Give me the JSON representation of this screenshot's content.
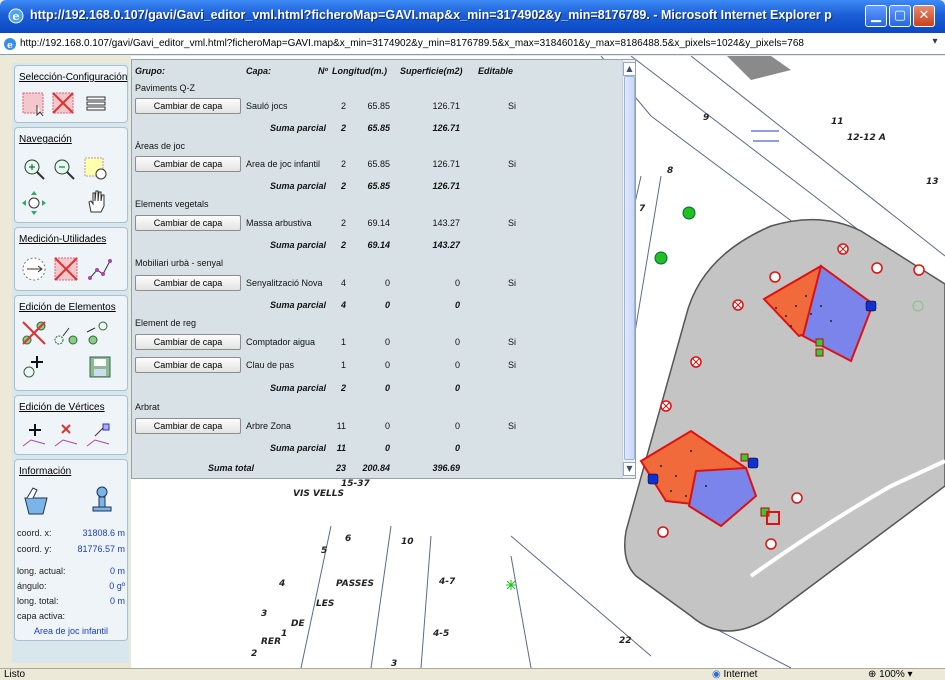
{
  "window": {
    "title": "http://192.168.0.107/gavi/Gavi_editor_vml.html?ficheroMap=GAVI.map&x_min=3174902&y_min=8176789. - Microsoft Internet Explorer p",
    "address": "http://192.168.0.107/gavi/Gavi_editor_vml.html?ficheroMap=GAVI.map&x_min=3174902&y_min=8176789.5&x_max=3184601&y_max=8186488.5&x_pixels=1024&y_pixels=768"
  },
  "status": {
    "text": "Listo",
    "zone": "Internet",
    "zoom": "100%"
  },
  "sidebar": {
    "sections": {
      "seleccion": "Selección-Configuración",
      "navegacion": "Navegación",
      "medicion": "Medición-Utilidades",
      "edicion_elementos": "Edición de Elementos",
      "edicion_vertices": "Edición de Vértices",
      "informacion": "Información"
    },
    "info": {
      "coord_x_label": "coord. x:",
      "coord_x": "31808.6 m",
      "coord_y_label": "coord. y:",
      "coord_y": "81776.57 m",
      "long_actual_label": "long. actual:",
      "long_actual": "0 m",
      "angulo_label": "ángulo:",
      "angulo": "0 gº",
      "long_total_label": "long. total:",
      "long_total": "0 m",
      "capa_activa_label": "capa activa:",
      "capa_activa": "Area de joc infantil"
    }
  },
  "table": {
    "headers": {
      "grupo": "Grupo:",
      "capa": "Capa:",
      "num": "Nº",
      "longitud": "Longitud(m.)",
      "superficie": "Superficie(m2)",
      "editable": "Editable"
    },
    "button_label": "Cambiar de capa",
    "subtotal_label": "Suma parcial",
    "total_label": "Suma total",
    "groups": [
      {
        "name": "Paviments Q-Z",
        "rows": [
          {
            "capa": "Sauló jocs",
            "n": "2",
            "long": "65.85",
            "sup": "126.71",
            "edit": "Si"
          }
        ],
        "sub": {
          "n": "2",
          "long": "65.85",
          "sup": "126.71"
        }
      },
      {
        "name": "Àreas de joc",
        "rows": [
          {
            "capa": "Area de joc infantil",
            "n": "2",
            "long": "65.85",
            "sup": "126.71",
            "edit": "Si"
          }
        ],
        "sub": {
          "n": "2",
          "long": "65.85",
          "sup": "126.71"
        }
      },
      {
        "name": "Elements vegetals",
        "rows": [
          {
            "capa": "Massa arbustiva",
            "n": "2",
            "long": "69.14",
            "sup": "143.27",
            "edit": "Si"
          }
        ],
        "sub": {
          "n": "2",
          "long": "69.14",
          "sup": "143.27"
        }
      },
      {
        "name": "Mobiliari urbà - senyal",
        "rows": [
          {
            "capa": "Senyalització Nova",
            "n": "4",
            "long": "0",
            "sup": "0",
            "edit": "Si"
          }
        ],
        "sub": {
          "n": "4",
          "long": "0",
          "sup": "0"
        }
      },
      {
        "name": "Element de reg",
        "rows": [
          {
            "capa": "Comptador aigua",
            "n": "1",
            "long": "0",
            "sup": "0",
            "edit": "Si"
          },
          {
            "capa": "Clau de pas",
            "n": "1",
            "long": "0",
            "sup": "0",
            "edit": "Si"
          }
        ],
        "sub": {
          "n": "2",
          "long": "0",
          "sup": "0"
        }
      },
      {
        "name": "Arbrat",
        "rows": [
          {
            "capa": "Arbre Zona",
            "n": "11",
            "long": "0",
            "sup": "0",
            "edit": "Si"
          }
        ],
        "sub": {
          "n": "11",
          "long": "0",
          "sup": "0"
        }
      }
    ],
    "total": {
      "n": "23",
      "long": "200.84",
      "sup": "396.69"
    }
  },
  "map": {
    "labels": [
      "11",
      "12-12 A",
      "13",
      "9",
      "8",
      "7",
      "5",
      "6",
      "4",
      "3",
      "1",
      "2",
      "10",
      "4-7",
      "4-5",
      "3",
      "22",
      "VIS VELLS",
      "15-37",
      "PASSES",
      "LES",
      "DE",
      "RER"
    ]
  }
}
